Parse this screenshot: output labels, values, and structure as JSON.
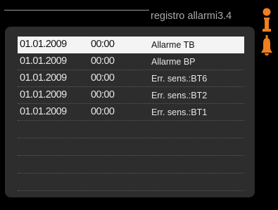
{
  "header": {
    "title": "registro allarmi",
    "menu_number": "3.4"
  },
  "side_icons": [
    "info-icon",
    "alarm-bell-icon"
  ],
  "colors": {
    "accent": "#f07f1e",
    "panel": "#2d2d2d",
    "selected_row": "#f4f4f4"
  },
  "alarms": [
    {
      "date": "01.01.2009",
      "time": "00:00",
      "message": "Allarme TB"
    },
    {
      "date": "01.01.2009",
      "time": "00:00",
      "message": "Allarme BP"
    },
    {
      "date": "01.01.2009",
      "time": "00:00",
      "message": "Err. sens.:BT6"
    },
    {
      "date": "01.01.2009",
      "time": "00:00",
      "message": "Err. sens.:BT2"
    },
    {
      "date": "01.01.2009",
      "time": "00:00",
      "message": "Err. sens.:BT1"
    }
  ]
}
